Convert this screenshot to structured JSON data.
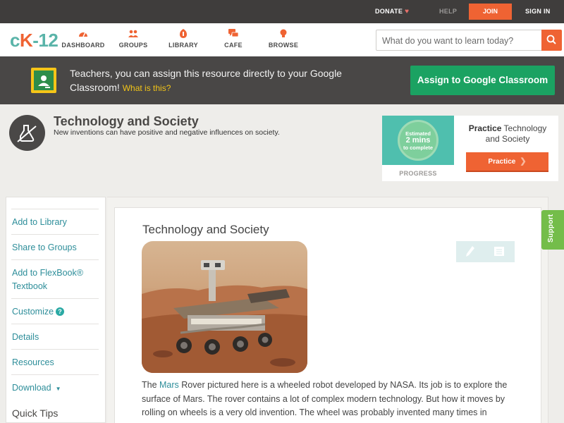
{
  "topbar": {
    "donate": "DONATE",
    "help": "HELP",
    "join": "JOIN",
    "signin": "SIGN IN"
  },
  "nav": {
    "logo_left": "c",
    "logo_k": "K",
    "logo_right": "-12",
    "items": [
      {
        "label": "DASHBOARD",
        "icon": "dashboard-icon"
      },
      {
        "label": "GROUPS",
        "icon": "groups-icon"
      },
      {
        "label": "LIBRARY",
        "icon": "library-icon"
      },
      {
        "label": "CAFE",
        "icon": "cafe-icon"
      },
      {
        "label": "BROWSE",
        "icon": "browse-icon"
      }
    ],
    "search_placeholder": "What do you want to learn today?"
  },
  "google_banner": {
    "text": "Teachers, you can assign this resource directly to your Google Classroom!",
    "what_link": "What is this?",
    "button": "Assign to Google Classroom"
  },
  "concept": {
    "title": "Technology and Society",
    "subtitle": "New inventions can have positive and negative influences on society."
  },
  "practice": {
    "estimate_line1": "Estimated",
    "estimate_line2": "2 mins",
    "estimate_line3": "to complete",
    "progress_label": "PROGRESS",
    "title_bold": "Practice",
    "title_rest": "Technology and Society",
    "button": "Practice"
  },
  "sidebar": {
    "items": [
      {
        "label": "Add to Library"
      },
      {
        "label": "Share to Groups"
      },
      {
        "label": "Add to FlexBook® Textbook"
      },
      {
        "label": "Customize"
      },
      {
        "label": "Details"
      },
      {
        "label": "Resources"
      },
      {
        "label": "Download"
      }
    ],
    "quick_tips": "Quick Tips"
  },
  "article": {
    "title": "Technology and Society",
    "para_pre": "The ",
    "para_link": "Mars",
    "para_post": " Rover pictured here is a wheeled robot developed by NASA. Its job is to explore the surface of Mars. The rover contains a lot of complex modern technology. But how it moves by rolling on wheels is a very old invention. The wheel was probably invented many times in"
  },
  "support_tab": "Support",
  "colors": {
    "brand_orange": "#ef6333",
    "brand_teal": "#5ab4a9",
    "link_teal": "#2e8e9a",
    "google_green": "#1ba262",
    "support_green": "#74bd4a"
  }
}
